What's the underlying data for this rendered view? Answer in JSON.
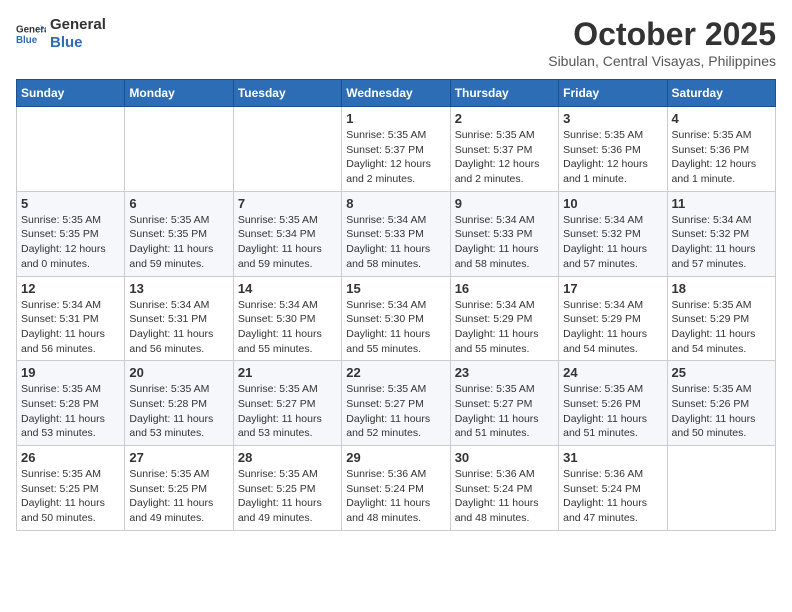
{
  "logo": {
    "line1": "General",
    "line2": "Blue"
  },
  "title": "October 2025",
  "location": "Sibulan, Central Visayas, Philippines",
  "days_of_week": [
    "Sunday",
    "Monday",
    "Tuesday",
    "Wednesday",
    "Thursday",
    "Friday",
    "Saturday"
  ],
  "weeks": [
    [
      {
        "day": "",
        "content": ""
      },
      {
        "day": "",
        "content": ""
      },
      {
        "day": "",
        "content": ""
      },
      {
        "day": "1",
        "content": "Sunrise: 5:35 AM\nSunset: 5:37 PM\nDaylight: 12 hours and 2 minutes."
      },
      {
        "day": "2",
        "content": "Sunrise: 5:35 AM\nSunset: 5:37 PM\nDaylight: 12 hours and 2 minutes."
      },
      {
        "day": "3",
        "content": "Sunrise: 5:35 AM\nSunset: 5:36 PM\nDaylight: 12 hours and 1 minute."
      },
      {
        "day": "4",
        "content": "Sunrise: 5:35 AM\nSunset: 5:36 PM\nDaylight: 12 hours and 1 minute."
      }
    ],
    [
      {
        "day": "5",
        "content": "Sunrise: 5:35 AM\nSunset: 5:35 PM\nDaylight: 12 hours and 0 minutes."
      },
      {
        "day": "6",
        "content": "Sunrise: 5:35 AM\nSunset: 5:35 PM\nDaylight: 11 hours and 59 minutes."
      },
      {
        "day": "7",
        "content": "Sunrise: 5:35 AM\nSunset: 5:34 PM\nDaylight: 11 hours and 59 minutes."
      },
      {
        "day": "8",
        "content": "Sunrise: 5:34 AM\nSunset: 5:33 PM\nDaylight: 11 hours and 58 minutes."
      },
      {
        "day": "9",
        "content": "Sunrise: 5:34 AM\nSunset: 5:33 PM\nDaylight: 11 hours and 58 minutes."
      },
      {
        "day": "10",
        "content": "Sunrise: 5:34 AM\nSunset: 5:32 PM\nDaylight: 11 hours and 57 minutes."
      },
      {
        "day": "11",
        "content": "Sunrise: 5:34 AM\nSunset: 5:32 PM\nDaylight: 11 hours and 57 minutes."
      }
    ],
    [
      {
        "day": "12",
        "content": "Sunrise: 5:34 AM\nSunset: 5:31 PM\nDaylight: 11 hours and 56 minutes."
      },
      {
        "day": "13",
        "content": "Sunrise: 5:34 AM\nSunset: 5:31 PM\nDaylight: 11 hours and 56 minutes."
      },
      {
        "day": "14",
        "content": "Sunrise: 5:34 AM\nSunset: 5:30 PM\nDaylight: 11 hours and 55 minutes."
      },
      {
        "day": "15",
        "content": "Sunrise: 5:34 AM\nSunset: 5:30 PM\nDaylight: 11 hours and 55 minutes."
      },
      {
        "day": "16",
        "content": "Sunrise: 5:34 AM\nSunset: 5:29 PM\nDaylight: 11 hours and 55 minutes."
      },
      {
        "day": "17",
        "content": "Sunrise: 5:34 AM\nSunset: 5:29 PM\nDaylight: 11 hours and 54 minutes."
      },
      {
        "day": "18",
        "content": "Sunrise: 5:35 AM\nSunset: 5:29 PM\nDaylight: 11 hours and 54 minutes."
      }
    ],
    [
      {
        "day": "19",
        "content": "Sunrise: 5:35 AM\nSunset: 5:28 PM\nDaylight: 11 hours and 53 minutes."
      },
      {
        "day": "20",
        "content": "Sunrise: 5:35 AM\nSunset: 5:28 PM\nDaylight: 11 hours and 53 minutes."
      },
      {
        "day": "21",
        "content": "Sunrise: 5:35 AM\nSunset: 5:27 PM\nDaylight: 11 hours and 53 minutes."
      },
      {
        "day": "22",
        "content": "Sunrise: 5:35 AM\nSunset: 5:27 PM\nDaylight: 11 hours and 52 minutes."
      },
      {
        "day": "23",
        "content": "Sunrise: 5:35 AM\nSunset: 5:27 PM\nDaylight: 11 hours and 51 minutes."
      },
      {
        "day": "24",
        "content": "Sunrise: 5:35 AM\nSunset: 5:26 PM\nDaylight: 11 hours and 51 minutes."
      },
      {
        "day": "25",
        "content": "Sunrise: 5:35 AM\nSunset: 5:26 PM\nDaylight: 11 hours and 50 minutes."
      }
    ],
    [
      {
        "day": "26",
        "content": "Sunrise: 5:35 AM\nSunset: 5:25 PM\nDaylight: 11 hours and 50 minutes."
      },
      {
        "day": "27",
        "content": "Sunrise: 5:35 AM\nSunset: 5:25 PM\nDaylight: 11 hours and 49 minutes."
      },
      {
        "day": "28",
        "content": "Sunrise: 5:35 AM\nSunset: 5:25 PM\nDaylight: 11 hours and 49 minutes."
      },
      {
        "day": "29",
        "content": "Sunrise: 5:36 AM\nSunset: 5:24 PM\nDaylight: 11 hours and 48 minutes."
      },
      {
        "day": "30",
        "content": "Sunrise: 5:36 AM\nSunset: 5:24 PM\nDaylight: 11 hours and 48 minutes."
      },
      {
        "day": "31",
        "content": "Sunrise: 5:36 AM\nSunset: 5:24 PM\nDaylight: 11 hours and 47 minutes."
      },
      {
        "day": "",
        "content": ""
      }
    ]
  ]
}
